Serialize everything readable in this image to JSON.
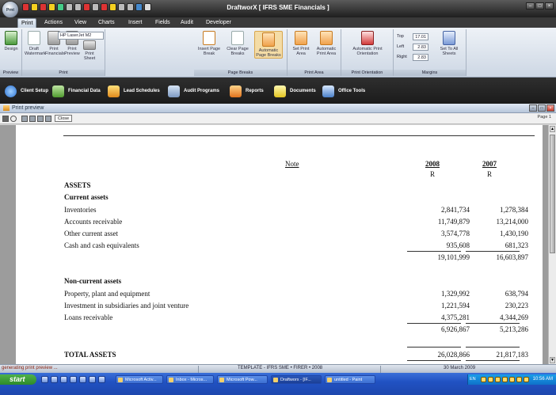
{
  "window": {
    "title": "DraftworX [ IFRS SME Financials ]",
    "orb_label": "Prnt"
  },
  "ribbon_tabs": [
    "Print",
    "Actions",
    "View",
    "Charts",
    "Insert",
    "Fields",
    "Audit",
    "Developer"
  ],
  "ribbon": {
    "groups": {
      "preview": "Preview",
      "print": "Print",
      "page_breaks": "Page Breaks",
      "print_area": "Print Area",
      "print_orientation": "Print Orientation",
      "margins": "Margins"
    },
    "buttons": {
      "design": "Design",
      "draft_watermark": "Draft Watermark",
      "print_financials": "Print Financials",
      "print_preview": "Print Preview",
      "print_sheet": "Print Sheet",
      "insert_page_break": "Insert Page Break",
      "clear_page_breaks": "Clear Page Breaks",
      "automatic_page_breaks": "Automatic Page Breaks",
      "set_print_area": "Set Print Area",
      "automatic_print_area": "Automatic Print Area",
      "automatic_print_orientation": "Automatic Print Orientation",
      "set_to_all_sheets": "Set To All Sheets"
    },
    "printer": "HP LaserJet M2",
    "margins": {
      "top_label": "Top",
      "top": "17.01",
      "left_label": "Left",
      "left": "2.83",
      "right_label": "Right",
      "right": "2.83"
    }
  },
  "modules": [
    "Client Setup",
    "Financial Data",
    "Lead Schedules",
    "Audit Programs",
    "Reports",
    "Documents",
    "Office Tools"
  ],
  "preview": {
    "title": "Print preview",
    "close_label": "Close",
    "page_label": "Page",
    "page_value": "1"
  },
  "document": {
    "note_header": "Note",
    "years": [
      "2008",
      "2007"
    ],
    "currency": "R",
    "assets_heading": "ASSETS",
    "current_heading": "Current assets",
    "current_rows": [
      {
        "label": "Inventories",
        "v2008": "2,841,734",
        "v2007": "1,278,384"
      },
      {
        "label": "Accounts receivable",
        "v2008": "11,749,879",
        "v2007": "13,214,000"
      },
      {
        "label": "Other current asset",
        "v2008": "3,574,778",
        "v2007": "1,430,190"
      },
      {
        "label": "Cash and cash equivalents",
        "v2008": "935,608",
        "v2007": "681,323"
      }
    ],
    "current_total": {
      "v2008": "19,101,999",
      "v2007": "16,603,897"
    },
    "noncurrent_heading": "Non-current assets",
    "noncurrent_rows": [
      {
        "label": "Property, plant and equipment",
        "v2008": "1,329,992",
        "v2007": "638,794"
      },
      {
        "label": "Investment in subsidiaries and joint venture",
        "v2008": "1,221,594",
        "v2007": "230,223"
      },
      {
        "label": "Loans receivable",
        "v2008": "4,375,281",
        "v2007": "4,344,269"
      }
    ],
    "noncurrent_total": {
      "v2008": "6,926,867",
      "v2007": "5,213,286"
    },
    "total_label": "TOTAL ASSETS",
    "total": {
      "v2008": "26,028,866",
      "v2007": "21,817,183"
    }
  },
  "statusbar": {
    "left": "generating print preview ...",
    "center": "TEMPLATE - IFRS SME • FIRER  •  2008",
    "right": "30 March 2009"
  },
  "taskbar": {
    "start": "start",
    "tasks": [
      "Microsoft Activ...",
      "Inbox - Micros...",
      "Microsoft Pow...",
      "Draftworx - [IF...",
      "untitled - Paint"
    ],
    "clock": "10:56 AM",
    "lang": "EN"
  }
}
